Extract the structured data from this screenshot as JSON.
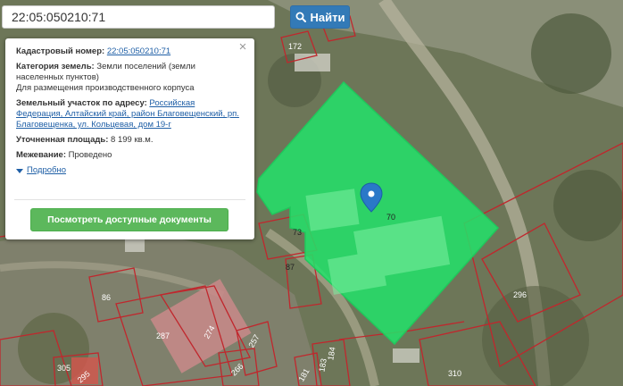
{
  "search": {
    "value": "22:05:050210:71",
    "button_label": "Найти"
  },
  "popup": {
    "cadastral_label": "Кадастровый номер:",
    "cadastral_value": "22:05:050210:71",
    "category_label": "Категория земель:",
    "category_value": "Земли поселений (земли населенных пунктов)",
    "usage": "Для размещения производственного корпуса",
    "address_label": "Земельный участок по адресу:",
    "address_value": "Российская Федерация, Алтайский край, район Благовещенский, рп. Благовещенка, ул. Кольцевая, дом 19-г",
    "area_label": "Уточненная площадь:",
    "area_value": "8 199 кв.м.",
    "survey_label": "Межевание:",
    "survey_value": "Проведено",
    "details_label": "Подробно",
    "docs_button": "Посмотреть доступные документы",
    "close_symbol": "×"
  },
  "map": {
    "selected_plot": "70",
    "plot_labels": [
      "172",
      "73",
      "87",
      "86",
      "296",
      "287",
      "274",
      "257",
      "266",
      "184",
      "183",
      "181",
      "310",
      "305",
      "295"
    ],
    "highlight_color": "#22e36a",
    "boundary_color": "#c0272d"
  }
}
